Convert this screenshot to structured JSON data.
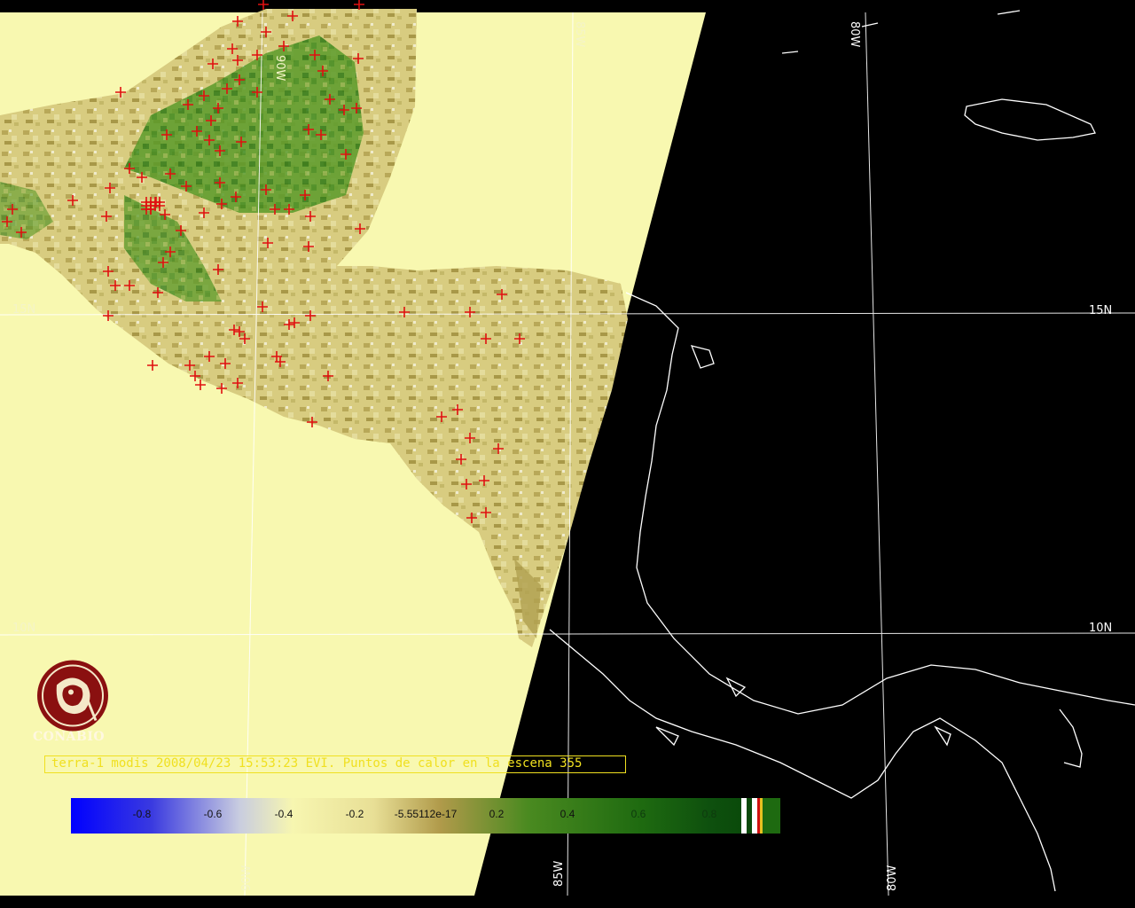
{
  "map": {
    "grid_labels": {
      "lat_15": "15N",
      "lat_10": "10N",
      "lon_90": "90W",
      "lon_85": "85W",
      "lon_80": "80W"
    },
    "logo_text": "CONABIO",
    "caption": "terra-1 modis 2008/04/23 15:53:23 EVI. Puntos de calor en la escena 355",
    "colorbar": {
      "ticks": [
        "-0.8",
        "-0.6",
        "-0.4",
        "-0.2",
        "-5.55112e-17",
        "0.2",
        "0.4",
        "0.6",
        "0.8"
      ],
      "colors": [
        "#0000ff",
        "#c8d0c8",
        "#f7f6b0",
        "#b8a050",
        "#2a7a10",
        "#0a4a0a"
      ]
    },
    "colors": {
      "background": "#000000",
      "scene_fill": "#f8f8b0",
      "hotspot": "#e01010",
      "coastline": "#ffffff",
      "caption": "#f0e020"
    }
  }
}
